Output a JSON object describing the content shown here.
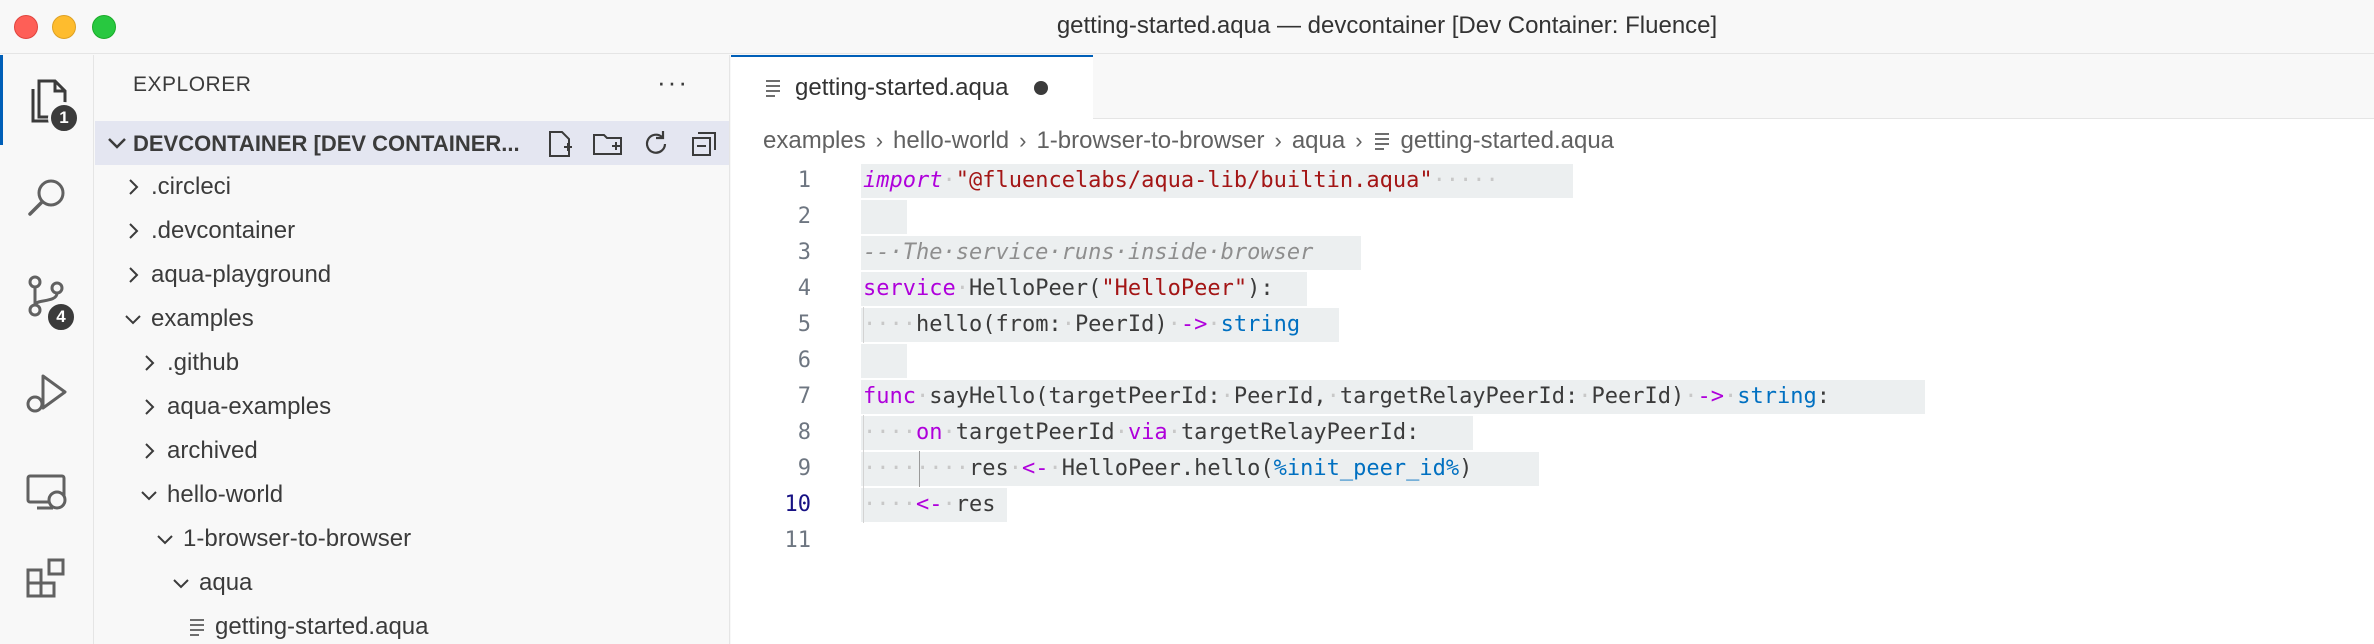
{
  "window": {
    "title": "getting-started.aqua — devcontainer [Dev Container: Fluence]"
  },
  "activity_bar": {
    "explorer_badge": "1",
    "scm_badge": "4"
  },
  "sidebar": {
    "title": "EXPLORER",
    "more": "···",
    "workspace": "DEVCONTAINER [DEV CONTAINER...",
    "items": [
      {
        "label": ".circleci",
        "expanded": false
      },
      {
        "label": ".devcontainer",
        "expanded": false
      },
      {
        "label": "aqua-playground",
        "expanded": false
      },
      {
        "label": "examples",
        "expanded": true
      },
      {
        "label": ".github",
        "expanded": false
      },
      {
        "label": "aqua-examples",
        "expanded": false
      },
      {
        "label": "archived",
        "expanded": false
      },
      {
        "label": "hello-world",
        "expanded": true
      },
      {
        "label": "1-browser-to-browser",
        "expanded": true
      },
      {
        "label": "aqua",
        "expanded": true
      },
      {
        "label": "getting-started.aqua",
        "file": true
      }
    ]
  },
  "editor": {
    "tab_label": "getting-started.aqua",
    "breadcrumbs": [
      "examples",
      "hello-world",
      "1-browser-to-browser",
      "aqua",
      "getting-started.aqua"
    ],
    "line_numbers": [
      "1",
      "2",
      "3",
      "4",
      "5",
      "6",
      "7",
      "8",
      "9",
      "10",
      "11"
    ],
    "current_line": "10"
  },
  "colors": {
    "accent": "#005fb8",
    "keyword": "#af00db",
    "string": "#a31515",
    "type": "#0070c1",
    "comment": "#8e8e8e"
  }
}
